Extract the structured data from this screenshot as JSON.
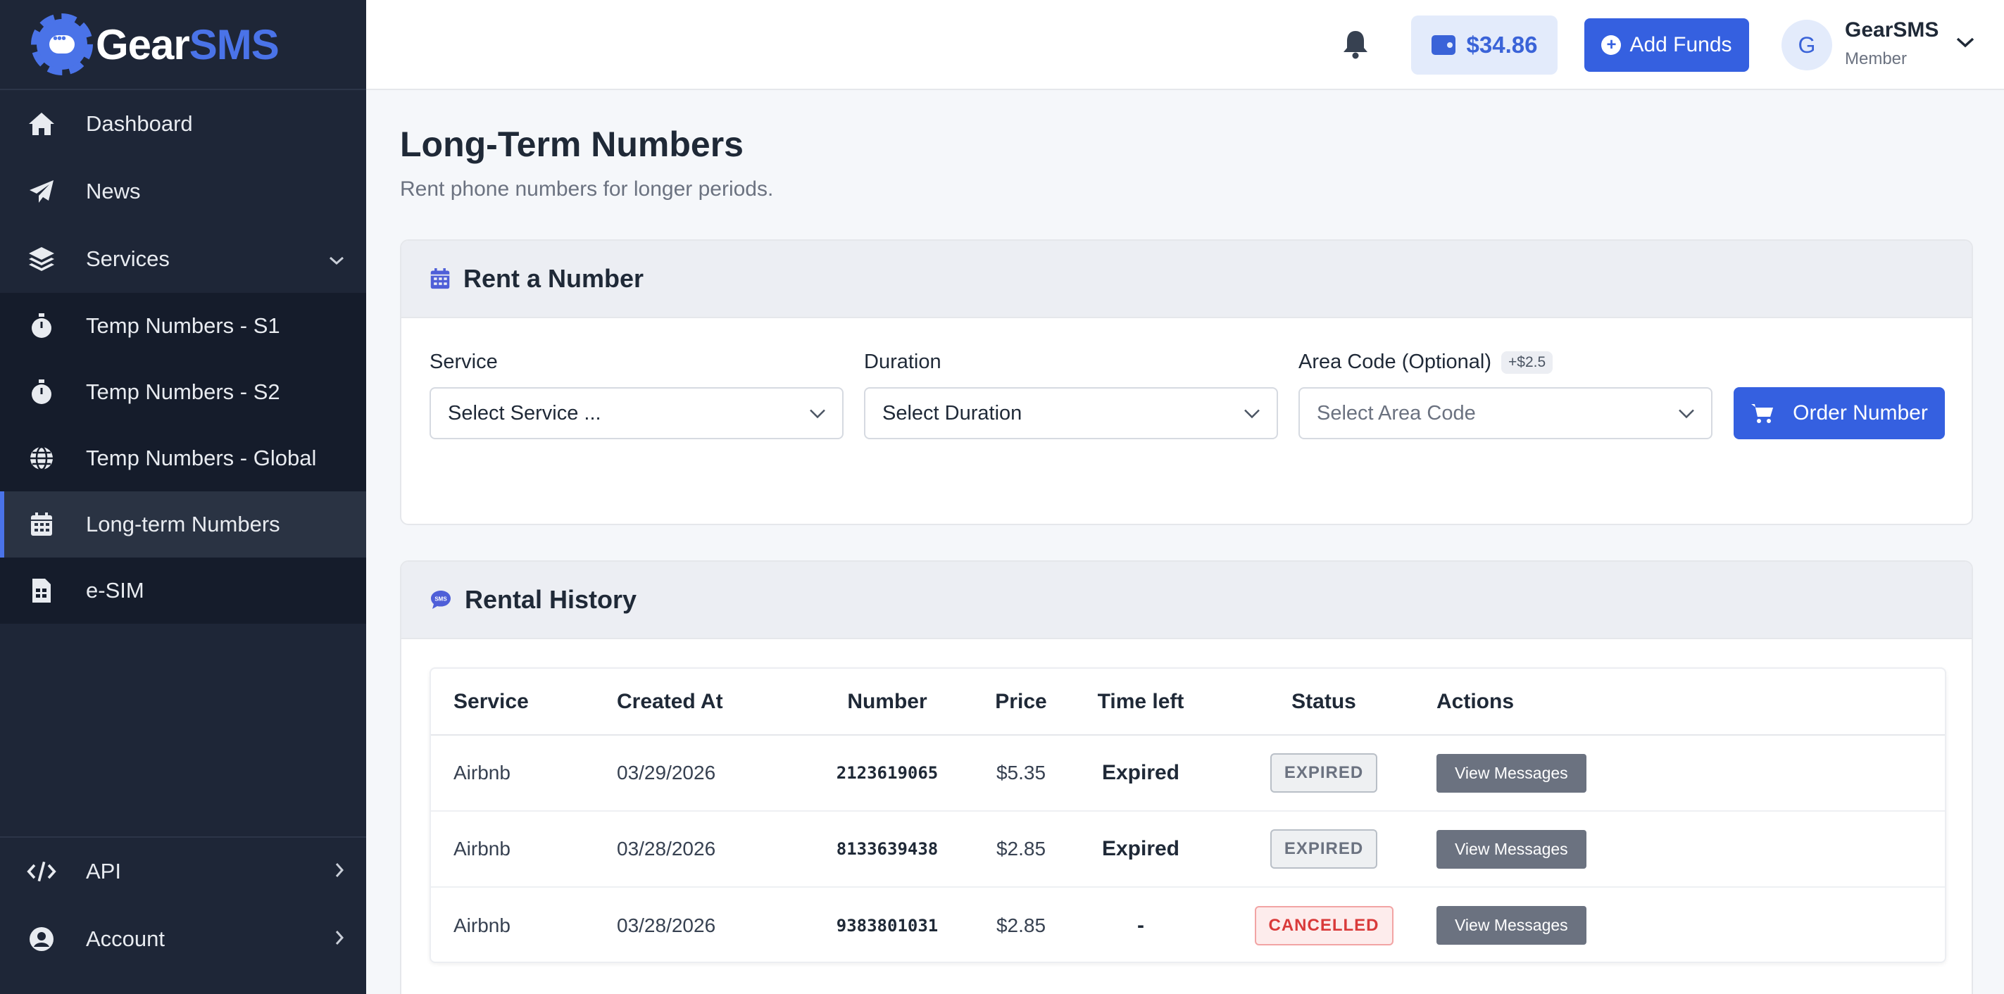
{
  "brand": {
    "name_part1": "Gear",
    "name_part2": "SMS"
  },
  "sidebar": {
    "items": [
      {
        "label": "Dashboard",
        "icon": "home-icon"
      },
      {
        "label": "News",
        "icon": "paper-plane-icon"
      },
      {
        "label": "Services",
        "icon": "layers-icon"
      },
      {
        "label": "Temp Numbers - S1",
        "icon": "stopwatch-icon"
      },
      {
        "label": "Temp Numbers - S2",
        "icon": "stopwatch-icon"
      },
      {
        "label": "Temp Numbers - Global",
        "icon": "globe-icon"
      },
      {
        "label": "Long-term Numbers",
        "icon": "calendar-icon",
        "active": true
      },
      {
        "label": "e-SIM",
        "icon": "sim-card-icon"
      }
    ],
    "bottom": [
      {
        "label": "API",
        "icon": "code-icon"
      },
      {
        "label": "Account",
        "icon": "user-circle-icon"
      }
    ]
  },
  "topbar": {
    "balance": "$34.86",
    "add_funds": "Add Funds",
    "avatar_initial": "G",
    "user_name": "GearSMS",
    "user_role": "Member"
  },
  "page": {
    "title": "Long-Term Numbers",
    "subtitle": "Rent phone numbers for longer periods."
  },
  "rent": {
    "title": "Rent a Number",
    "service_label": "Service",
    "service_value": "Select Service ...",
    "duration_label": "Duration",
    "duration_value": "Select Duration",
    "area_label": "Area Code (Optional)",
    "area_badge": "+$2.5",
    "area_placeholder": "Select Area Code",
    "order_button": "Order Number"
  },
  "history": {
    "title": "Rental History",
    "columns": [
      "Service",
      "Created At",
      "Number",
      "Price",
      "Time left",
      "Status",
      "Actions"
    ],
    "rows": [
      {
        "service": "Airbnb",
        "created": "03/29/2026",
        "number": "2123619065",
        "price": "$5.35",
        "time_left": "Expired",
        "status": "EXPIRED",
        "action": "View Messages"
      },
      {
        "service": "Airbnb",
        "created": "03/28/2026",
        "number": "8133639438",
        "price": "$2.85",
        "time_left": "Expired",
        "status": "EXPIRED",
        "action": "View Messages"
      },
      {
        "service": "Airbnb",
        "created": "03/28/2026",
        "number": "9383801031",
        "price": "$2.85",
        "time_left": "-",
        "status": "CANCELLED",
        "action": "View Messages"
      }
    ]
  },
  "colors": {
    "accent": "#3560e0",
    "sidebar_bg": "#1e2637",
    "cancelled": "#d93a3a"
  }
}
